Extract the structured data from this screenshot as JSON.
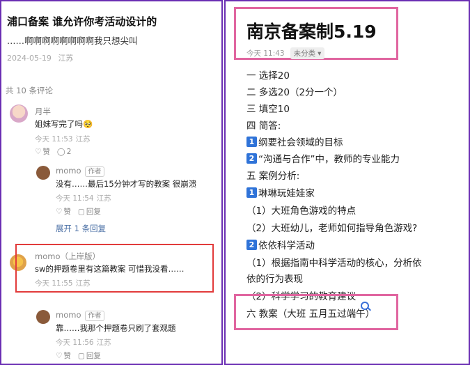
{
  "post": {
    "title": "浦口备案 谁允许你考活动设计的",
    "body": "……啊啊啊啊啊啊啊啊我只想尖叫",
    "date": "2024-05-19",
    "location": "江苏",
    "comment_count": "共 10 条评论"
  },
  "comments": [
    {
      "user": "月半",
      "text": "姐妹写完了吗🥺",
      "time": "今天 11:53",
      "location": "江苏",
      "like_label": "赞",
      "reply_count": "2"
    },
    {
      "user": "momo",
      "tag": "作者",
      "text": "没有……最后15分钟才写的教案 很崩溃",
      "time": "今天 11:54",
      "location": "江苏",
      "like_label": "赞",
      "reply_label": "回复"
    },
    {
      "expand_label": "展开 1 条回复"
    },
    {
      "user": "momo（上岸版）",
      "text": "sw的押题卷里有这篇教案 可惜我没看……",
      "time": "今天 11:55",
      "location": "江苏"
    },
    {
      "user": "momo",
      "tag": "作者",
      "text": "靠……我那个押题卷只刷了套观题",
      "time": "今天 11:56",
      "location": "江苏",
      "like_label": "赞",
      "reply_label": "回复"
    }
  ],
  "note": {
    "title": "南京备案制5.19",
    "time": "今天 11:43",
    "category": "未分类",
    "lines": [
      {
        "text": "一 选择20"
      },
      {
        "text": "二 多选20（2分一个）"
      },
      {
        "text": "三 填空10"
      },
      {
        "text": "四 简答:"
      },
      {
        "badge": "1",
        "text": "纲要社会领域的目标"
      },
      {
        "badge": "2",
        "text": "“沟通与合作”中，教师的专业能力"
      },
      {
        "text": "五 案例分析:"
      },
      {
        "badge": "1",
        "text": "琳琳玩娃娃家"
      },
      {
        "text": "（1）大班角色游戏的特点"
      },
      {
        "text": "（2）大班幼儿，老师如何指导角色游戏?"
      },
      {
        "badge": "2",
        "text": "依依科学活动"
      },
      {
        "text": "（1）根据指南中科学活动的核心，分析依"
      },
      {
        "text": "依的行为表现"
      },
      {
        "text": "（2）科学学习的教育建议"
      },
      {
        "text": "六 教案（大班 五月五过端午）"
      }
    ]
  },
  "colors": {
    "frame": "#6b2fb3",
    "red_highlight": "#e23b3b",
    "pink_highlight": "#e066a0",
    "badge_blue": "#2f73d8"
  }
}
